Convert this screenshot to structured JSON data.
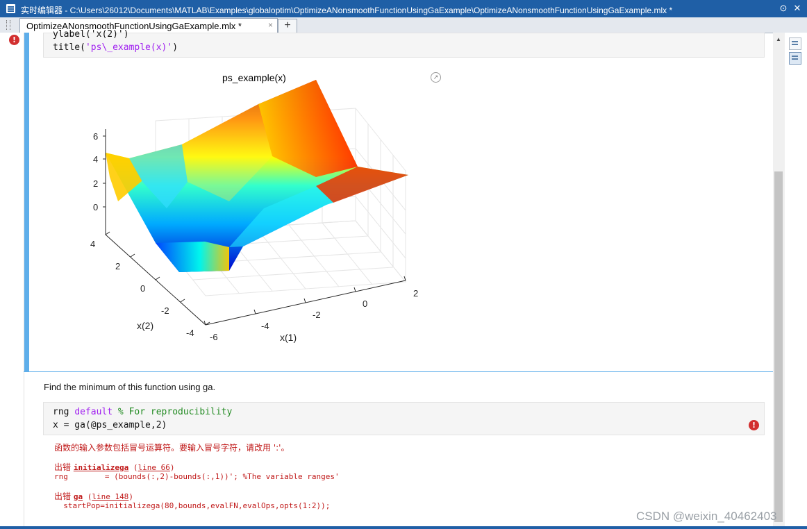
{
  "window": {
    "title": "实时编辑器 - C:\\Users\\26012\\Documents\\MATLAB\\Examples\\globaloptim\\OptimizeANonsmoothFunctionUsingGaExample\\OptimizeANonsmoothFunctionUsingGaExample.mlx *"
  },
  "tabs": [
    {
      "label": "OptimizeANonsmoothFunctionUsingGaExample.mlx *",
      "close": "×"
    }
  ],
  "tab_add": "+",
  "code_top": {
    "line1": "ylabel('x(2)')",
    "line2_fn": "title(",
    "line2_str": "'ps\\_example(x)'",
    "line2_end": ")"
  },
  "plot": {
    "title": "ps_example(x)",
    "z_ticks": [
      "6",
      "4",
      "2",
      "0"
    ],
    "y_ticks": [
      "4",
      "2",
      "0",
      "-2",
      "-4"
    ],
    "x_ticks": [
      "-6",
      "-4",
      "-2",
      "0",
      "2"
    ],
    "xlabel": "x(1)",
    "ylabel": "x(2)"
  },
  "prose": "Find the minimum of this function using ga.",
  "code_main": {
    "l1_a": "rng ",
    "l1_kw": "default",
    "l1_cm": " % For reproducibility",
    "l2": "x = ga(@ps_example,2)"
  },
  "error": {
    "message": "函数的输入参数包括冒号运算符。要输入冒号字符，请改用 ':'。",
    "e1_prefix": "出错 ",
    "e1_fn": "initializega",
    "e1_open": " (",
    "e1_line": "line 66",
    "e1_close": ")",
    "e1_code": "rng        = (bounds(:,2)-bounds(:,1))'; %The variable ranges'",
    "e2_prefix": "出错 ",
    "e2_fn": "ga",
    "e2_open": " (",
    "e2_line": "line 148",
    "e2_close": ")",
    "e2_code": "  startPop=initializega(80,bounds,evalFN,evalOps,opts(1:2));"
  },
  "watermark": "CSDN @weixin_40462403",
  "icons": [
    "app-icon",
    "minimize-icon",
    "close-icon",
    "error-icon",
    "expand-icon",
    "scroll-up-icon",
    "output-inline-icon",
    "output-right-icon"
  ]
}
